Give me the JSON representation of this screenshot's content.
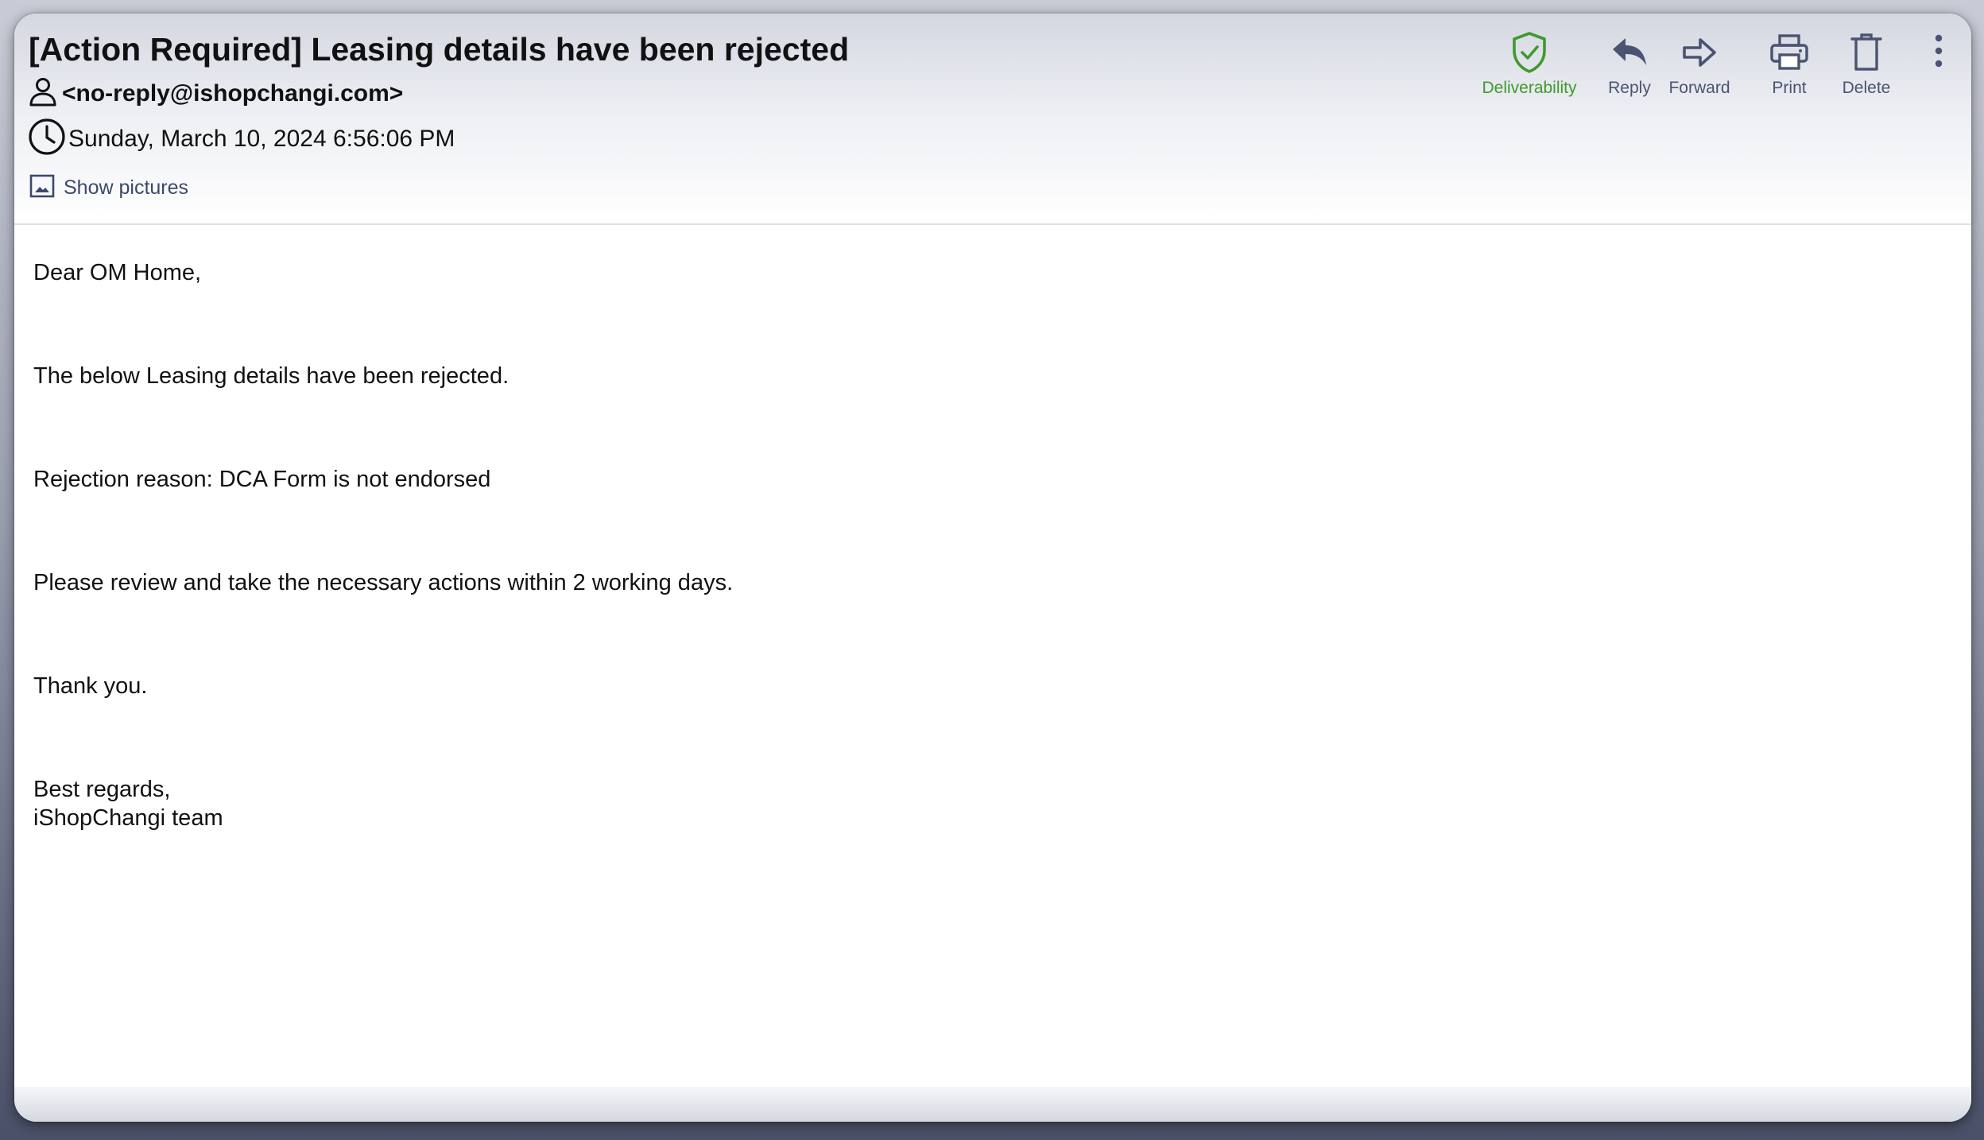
{
  "email": {
    "subject": "[Action Required] Leasing details have been rejected",
    "sender": "<no-reply@ishopchangi.com>",
    "date": "Sunday, March 10, 2024 6:56:06 PM",
    "show_pictures_label": "Show pictures"
  },
  "toolbar": {
    "deliverability_label": "Deliverability",
    "reply_label": "Reply",
    "forward_label": "Forward",
    "print_label": "Print",
    "delete_label": "Delete"
  },
  "body": {
    "greeting": "Dear OM Home,",
    "line1": "The below Leasing details have been rejected.",
    "line2": "Rejection reason: DCA Form is not endorsed",
    "line3": "Please review and take the necessary actions within 2 working days.",
    "line4": "Thank you.",
    "closing": "Best regards,",
    "signature": "iShopChangi team"
  },
  "icons": {
    "user": "user-icon",
    "clock": "clock-icon",
    "image": "image-icon",
    "deliverability": "shield-check-icon",
    "reply": "reply-icon",
    "forward": "forward-icon",
    "print": "printer-icon",
    "delete": "trash-icon",
    "more": "more-vertical-icon"
  },
  "colors": {
    "deliverability": "#3f9a2e",
    "toolbar_icon": "#4a5472",
    "link": "#3b4a6b"
  }
}
